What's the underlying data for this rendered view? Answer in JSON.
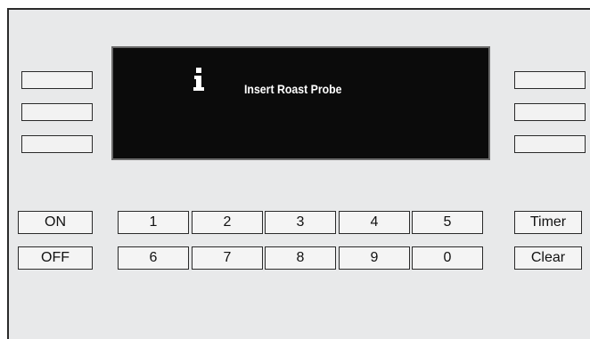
{
  "display": {
    "icon": "info-icon",
    "message": "Insert Roast Probe",
    "background_color": "#0b0b0b",
    "text_color": "#ffffff"
  },
  "power": {
    "on_label": "ON",
    "off_label": "OFF"
  },
  "keypad": {
    "row1": [
      "1",
      "2",
      "3",
      "4",
      "5"
    ],
    "row2": [
      "6",
      "7",
      "8",
      "9",
      "0"
    ]
  },
  "right_keys": {
    "timer_label": "Timer",
    "clear_label": "Clear"
  },
  "panel": {
    "background_color": "#e8e9ea",
    "border_color": "#2a2a2a"
  }
}
